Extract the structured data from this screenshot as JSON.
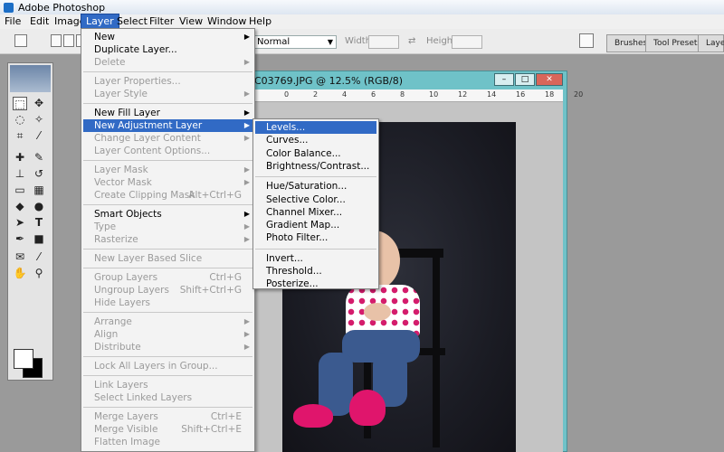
{
  "app": {
    "title": "Adobe Photoshop"
  },
  "menubar": [
    "File",
    "Edit",
    "Image",
    "Layer",
    "Select",
    "Filter",
    "View",
    "Window",
    "Help"
  ],
  "options": {
    "mode": "Normal",
    "width_label": "Width:",
    "height_label": "Height:",
    "panel_tabs": [
      "Brushes",
      "Tool Presets",
      "Laye"
    ]
  },
  "document": {
    "title": "C03769.JPG @ 12.5% (RGB/8)",
    "ruler": [
      "0",
      "2",
      "4",
      "6",
      "8",
      "10",
      "12",
      "14",
      "16",
      "18",
      "20"
    ]
  },
  "layer_menu": [
    {
      "label": "New",
      "submenu": true
    },
    {
      "label": "Duplicate Layer..."
    },
    {
      "label": "Delete",
      "disabled": true,
      "submenu": true
    },
    {
      "sep": true
    },
    {
      "label": "Layer Properties...",
      "disabled": true
    },
    {
      "label": "Layer Style",
      "disabled": true,
      "submenu": true
    },
    {
      "sep": true
    },
    {
      "label": "New Fill Layer",
      "submenu": true
    },
    {
      "label": "New Adjustment Layer",
      "submenu": true,
      "highlighted": true
    },
    {
      "label": "Change Layer Content",
      "disabled": true,
      "submenu": true
    },
    {
      "label": "Layer Content Options...",
      "disabled": true
    },
    {
      "sep": true
    },
    {
      "label": "Layer Mask",
      "disabled": true,
      "submenu": true
    },
    {
      "label": "Vector Mask",
      "disabled": true,
      "submenu": true
    },
    {
      "label": "Create Clipping Mask",
      "disabled": true,
      "shortcut": "Alt+Ctrl+G"
    },
    {
      "sep": true
    },
    {
      "label": "Smart Objects",
      "submenu": true
    },
    {
      "label": "Type",
      "disabled": true,
      "submenu": true
    },
    {
      "label": "Rasterize",
      "disabled": true,
      "submenu": true
    },
    {
      "sep": true
    },
    {
      "label": "New Layer Based Slice",
      "disabled": true
    },
    {
      "sep": true
    },
    {
      "label": "Group Layers",
      "disabled": true,
      "shortcut": "Ctrl+G"
    },
    {
      "label": "Ungroup Layers",
      "disabled": true,
      "shortcut": "Shift+Ctrl+G"
    },
    {
      "label": "Hide Layers",
      "disabled": true
    },
    {
      "sep": true
    },
    {
      "label": "Arrange",
      "disabled": true,
      "submenu": true
    },
    {
      "label": "Align",
      "disabled": true,
      "submenu": true
    },
    {
      "label": "Distribute",
      "disabled": true,
      "submenu": true
    },
    {
      "sep": true
    },
    {
      "label": "Lock All Layers in Group...",
      "disabled": true
    },
    {
      "sep": true
    },
    {
      "label": "Link Layers",
      "disabled": true
    },
    {
      "label": "Select Linked Layers",
      "disabled": true
    },
    {
      "sep": true
    },
    {
      "label": "Merge Layers",
      "disabled": true,
      "shortcut": "Ctrl+E"
    },
    {
      "label": "Merge Visible",
      "disabled": true,
      "shortcut": "Shift+Ctrl+E"
    },
    {
      "label": "Flatten Image",
      "disabled": true
    }
  ],
  "adjustment_submenu": [
    {
      "label": "Levels...",
      "highlighted": true
    },
    {
      "label": "Curves..."
    },
    {
      "label": "Color Balance..."
    },
    {
      "label": "Brightness/Contrast..."
    },
    {
      "sep": true
    },
    {
      "label": "Hue/Saturation..."
    },
    {
      "label": "Selective Color..."
    },
    {
      "label": "Channel Mixer..."
    },
    {
      "label": "Gradient Map..."
    },
    {
      "label": "Photo Filter..."
    },
    {
      "sep": true
    },
    {
      "label": "Invert..."
    },
    {
      "label": "Threshold..."
    },
    {
      "label": "Posterize..."
    }
  ],
  "colors": {
    "highlight": "#316ac5",
    "window_frame": "#6fc2c8"
  }
}
